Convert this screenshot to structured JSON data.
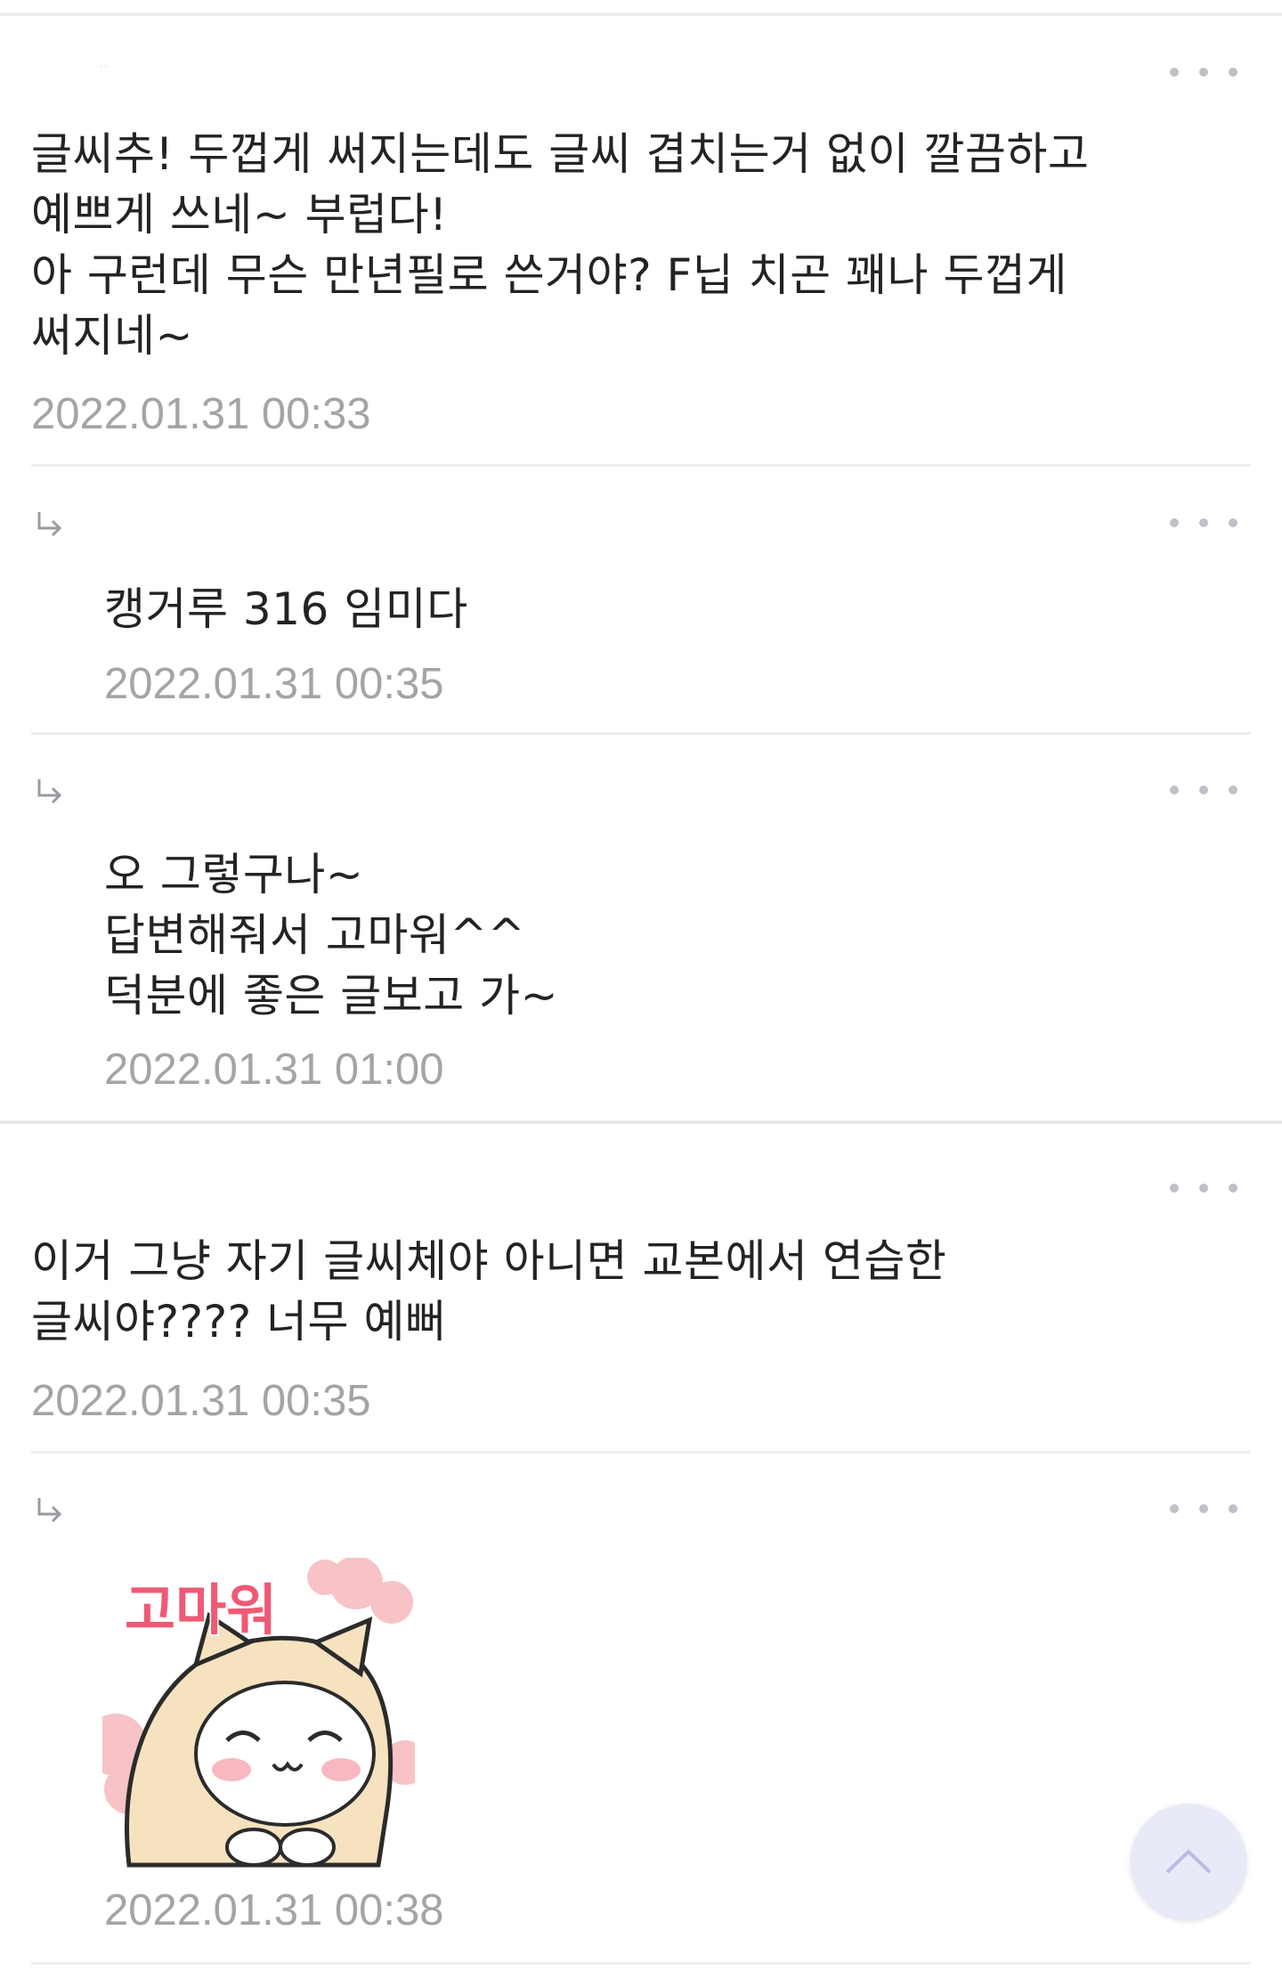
{
  "comments": [
    {
      "author": "··",
      "text": "글씨추! 두껍게 써지는데도 글씨 겹치는거 없이 깔끔하고\n예쁘게 쓰네~ 부럽다!\n아 구런데 무슨 만년필로 쓴거야? F닙 치곤 꽤나 두껍게\n써지네~",
      "date": "2022.01.31 00:33",
      "replies": [
        {
          "author": "",
          "text": "캥거루 316 임미다",
          "date": "2022.01.31 00:35"
        },
        {
          "author": "",
          "text": "오 그렇구나~\n답변해줘서 고마워^^\n덕분에 좋은 글보고 가~",
          "date": "2022.01.31 01:00"
        }
      ]
    },
    {
      "author": "",
      "text": "이거 그냥 자기 글씨체야 아니면 교본에서 연습한\n글씨야???? 너무 예뻐",
      "date": "2022.01.31 00:35",
      "replies": [
        {
          "author": "",
          "sticker": {
            "text": "고마워",
            "icon": "thank-you-sticker"
          },
          "date": "2022.01.31 00:38"
        }
      ]
    }
  ],
  "icons": {
    "more": "more-dots-icon",
    "reply": "reply-arrow-icon",
    "scroll_top": "chevron-up-icon"
  },
  "colors": {
    "text": "#232323",
    "date": "#a4a4a7",
    "divider": "#efeff1",
    "scroll_button": "#e8eaf7",
    "sticker_text": "#ee5a74"
  }
}
